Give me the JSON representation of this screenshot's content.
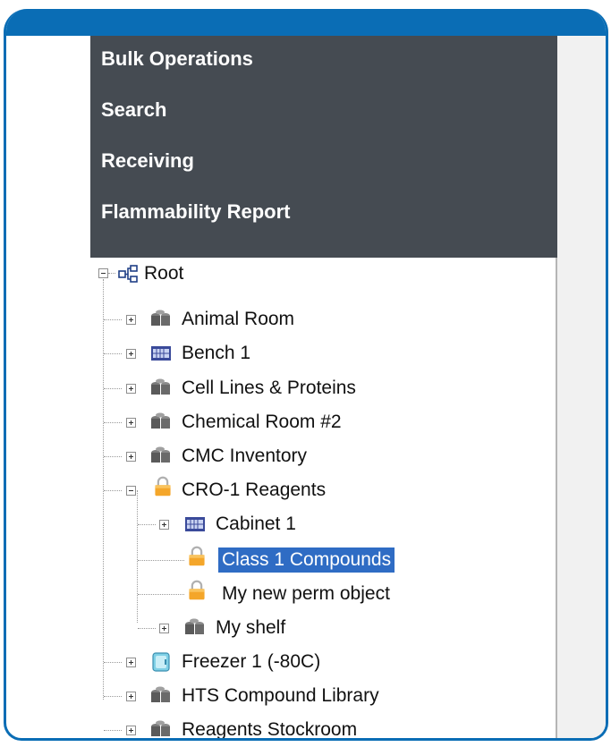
{
  "menu": {
    "items": [
      {
        "label": "Bulk Operations"
      },
      {
        "label": "Search"
      },
      {
        "label": "Receiving"
      },
      {
        "label": "Flammability Report"
      }
    ]
  },
  "tree": {
    "root": {
      "label": "Root",
      "icon": "hierarchy-icon"
    },
    "nodes": [
      {
        "label": "Animal Room",
        "icon": "shelf-icon",
        "expander": "plus"
      },
      {
        "label": "Bench 1",
        "icon": "bench-icon",
        "expander": "plus"
      },
      {
        "label": "Cell Lines & Proteins",
        "icon": "shelf-icon",
        "expander": "plus"
      },
      {
        "label": "Chemical Room #2",
        "icon": "shelf-icon",
        "expander": "plus"
      },
      {
        "label": "CMC Inventory",
        "icon": "shelf-icon",
        "expander": "plus"
      },
      {
        "label": "CRO-1 Reagents",
        "icon": "lock-icon",
        "expander": "minus"
      },
      {
        "label": "Cabinet 1",
        "icon": "bench-icon",
        "expander": "plus"
      },
      {
        "label": "Class 1 Compounds",
        "icon": "lock-icon",
        "selected": true
      },
      {
        "label": "My new perm object",
        "icon": "lock-icon"
      },
      {
        "label": "My shelf",
        "icon": "shelf-icon",
        "expander": "plus"
      },
      {
        "label": "Freezer 1 (-80C)",
        "icon": "freezer-icon",
        "expander": "plus"
      },
      {
        "label": "HTS Compound Library",
        "icon": "shelf-icon",
        "expander": "plus"
      },
      {
        "label": "Reagents Stockroom",
        "icon": "shelf-icon",
        "expander": "plus"
      }
    ]
  },
  "colors": {
    "frame_blue": "#0a6db5",
    "menu_bg": "#454b52",
    "selection_blue": "#2f6cc4"
  }
}
